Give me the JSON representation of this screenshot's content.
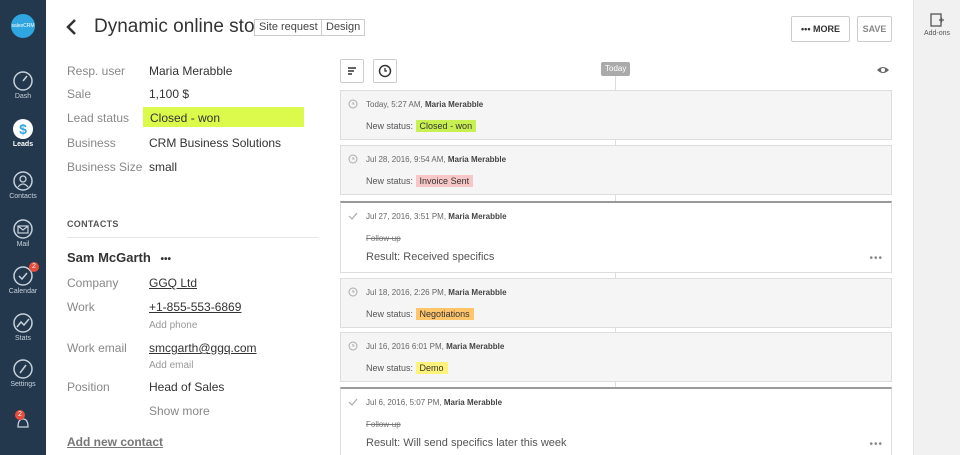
{
  "nav": {
    "logo_text": "salesCRM",
    "items": [
      {
        "label": "Dash",
        "icon": "dashboard-icon"
      },
      {
        "label": "Leads",
        "icon": "leads-dollar-icon"
      },
      {
        "label": "Contacts",
        "icon": "contacts-icon"
      },
      {
        "label": "Mail",
        "icon": "mail-icon"
      },
      {
        "label": "Calendar",
        "icon": "calendar-check-icon",
        "badge": "2"
      },
      {
        "label": "Stats",
        "icon": "stats-icon"
      },
      {
        "label": "Settings",
        "icon": "settings-icon"
      }
    ],
    "notification_badge": "2"
  },
  "rightrail": {
    "addons_label": "Add-ons"
  },
  "header": {
    "title": "Dynamic online store",
    "tags": [
      "Site request",
      "Design"
    ],
    "more_label": "MORE",
    "save_label": "SAVE"
  },
  "details": {
    "fields": [
      {
        "label": "Resp. user",
        "value": "Maria Merabble"
      },
      {
        "label": "Sale",
        "value": "1,100 $"
      },
      {
        "label": "Lead status",
        "value": "Closed - won"
      },
      {
        "label": "Business",
        "value": "CRM Business Solutions"
      },
      {
        "label": "Business Size",
        "value": "small"
      }
    ],
    "status_color": "#dcfa4c"
  },
  "contacts": {
    "section_title": "CONTACTS",
    "name": "Sam McGarth",
    "menu_dots": "•••",
    "company_label": "Company",
    "company_value": "GGQ Ltd",
    "work_label": "Work",
    "work_value": "+1-855-553-6869",
    "add_phone": "Add phone",
    "email_label": "Work email",
    "email_value": "smcgarth@ggq.com",
    "add_email": "Add email",
    "position_label": "Position",
    "position_value": "Head of Sales",
    "show_more": "Show more",
    "add_new_contact": "Add new contact"
  },
  "timeline": {
    "today_label": "Today",
    "events": [
      {
        "meta": "Today, 5:27 AM,",
        "user": "Maria Merabble",
        "prefix": "New status:",
        "status": "Closed - won",
        "color": "#c8f050"
      },
      {
        "meta": "Jul 28, 2016, 9:54 AM,",
        "user": "Maria Merabble",
        "prefix": "New status:",
        "status": "Invoice Sent",
        "color": "#f7c6c6"
      },
      {
        "meta": "Jul 27, 2016, 3:51 PM,",
        "user": "Maria Merabble",
        "task": "Follow-up",
        "result": "Result: Received specifics"
      },
      {
        "meta": "Jul 18, 2016, 2:26 PM,",
        "user": "Maria Merabble",
        "prefix": "New status:",
        "status": "Negotiations",
        "color": "#ffc56b"
      },
      {
        "meta": "Jul 16, 2016 6:01 PM,",
        "user": "Maria Merabble",
        "prefix": "New status:",
        "status": "Demo",
        "color": "#fff27a"
      },
      {
        "meta": "Jul 6, 2016, 5:07 PM,",
        "user": "Maria Merabble",
        "task": "Follow-up",
        "result": "Result: Will send specifics later this week"
      }
    ],
    "dots": "•••"
  }
}
